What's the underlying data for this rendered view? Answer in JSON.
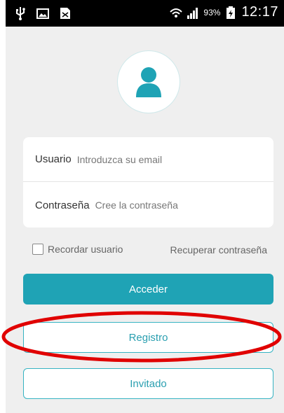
{
  "status_bar": {
    "left_icons": [
      "usb-icon",
      "image-icon",
      "sim-icon"
    ],
    "battery_percent": "93%",
    "time": "12:17"
  },
  "login": {
    "user_label": "Usuario",
    "user_placeholder": "Introduzca su email",
    "password_label": "Contraseña",
    "password_placeholder": "Cree la contraseña",
    "remember_label": "Recordar usuario",
    "remember_checked": false,
    "recover_label": "Recuperar contraseña",
    "login_button": "Acceder",
    "register_button": "Registro",
    "guest_button": "Invitado"
  },
  "colors": {
    "accent": "#1fa3b5",
    "background": "#efefef",
    "annotation": "#e00000"
  }
}
